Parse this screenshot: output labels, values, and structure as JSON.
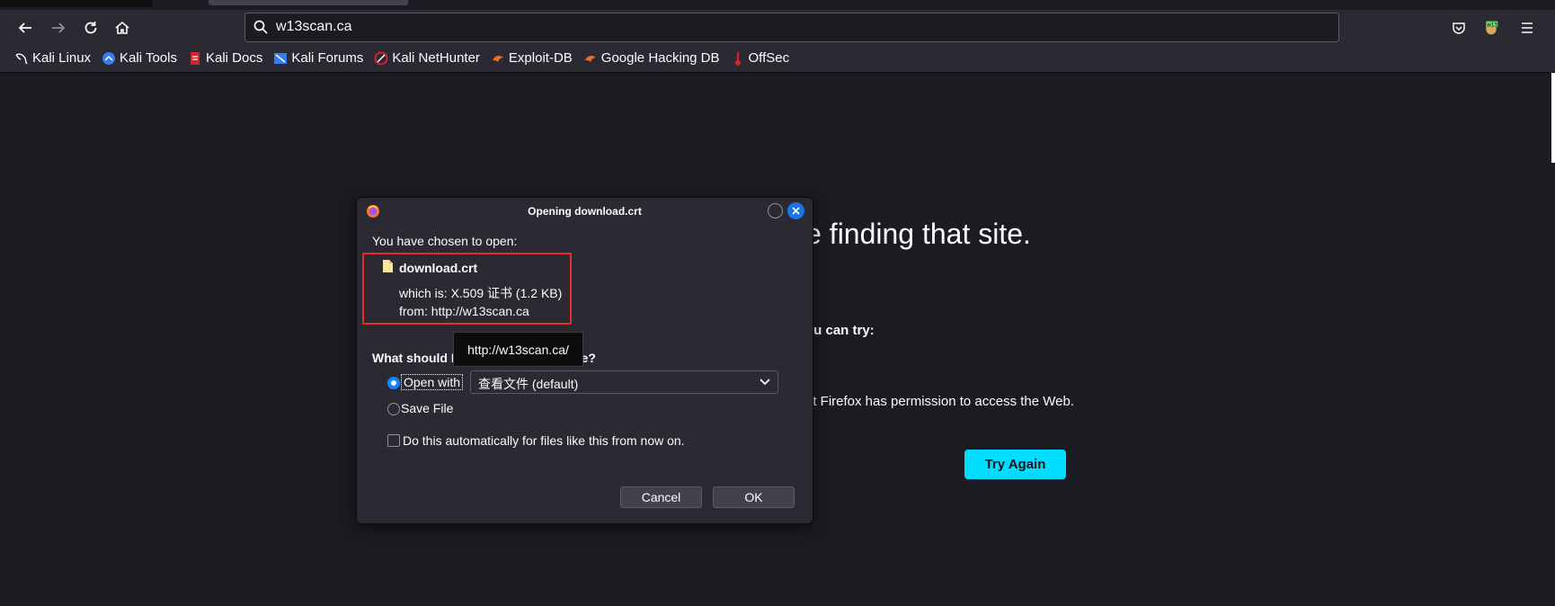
{
  "browser": {
    "url": "w13scan.ca",
    "bookmarks": [
      {
        "label": "Kali Linux",
        "icon": "kali-dragon-icon"
      },
      {
        "label": "Kali Tools",
        "icon": "kali-tools-icon"
      },
      {
        "label": "Kali Docs",
        "icon": "kali-docs-icon"
      },
      {
        "label": "Kali Forums",
        "icon": "kali-forums-icon"
      },
      {
        "label": "Kali NetHunter",
        "icon": "kali-nethunter-icon"
      },
      {
        "label": "Exploit-DB",
        "icon": "exploit-db-icon"
      },
      {
        "label": "Google Hacking DB",
        "icon": "ghdb-icon"
      },
      {
        "label": "OffSec",
        "icon": "offsec-icon"
      }
    ]
  },
  "error_page": {
    "title_fragment": "le finding that site.",
    "try_fragment": "ou can try:",
    "permission_fragment": "at Firefox has permission to access the Web.",
    "try_again_label": "Try Again"
  },
  "dialog": {
    "title": "Opening download.crt",
    "chosen_label": "You have chosen to open:",
    "filename": "download.crt",
    "which_is": "which is: X.509 证书 (1.2 KB)",
    "from": "from:  http://w13scan.ca",
    "question": "What should Firefox do with this file?",
    "tooltip": "http://w13scan.ca/",
    "open_with_label": "Open with",
    "open_with_value": "查看文件 (default)",
    "save_file_label": "Save File",
    "auto_label": "Do this automatically for files like this from now on.",
    "cancel_label": "Cancel",
    "ok_label": "OK"
  },
  "colors": {
    "accent": "#0a84ff",
    "try_again_bg": "#00ddff",
    "highlight_border": "#e52d2d"
  }
}
